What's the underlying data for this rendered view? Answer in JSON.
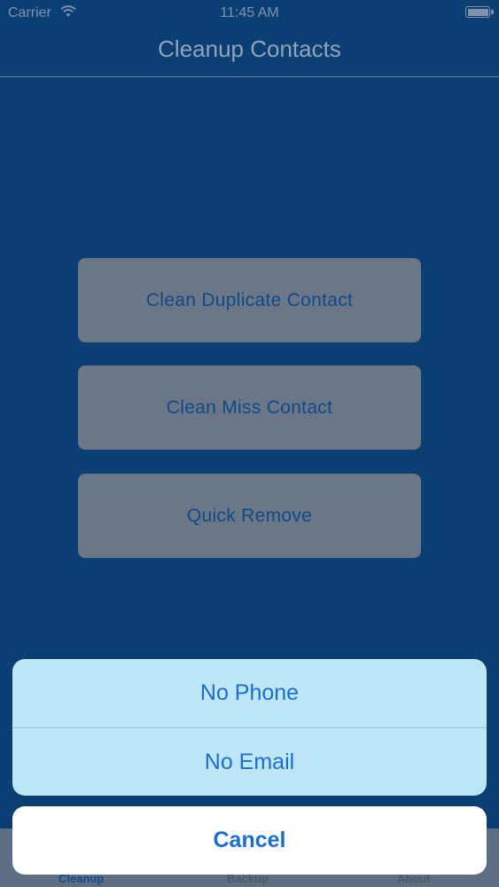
{
  "status_bar": {
    "carrier": "Carrier",
    "time": "11:45 AM",
    "wifi_icon": "wifi-icon",
    "battery_icon": "battery-icon"
  },
  "nav": {
    "title": "Cleanup Contacts"
  },
  "buttons": {
    "clean_duplicate": "Clean Duplicate Contact",
    "clean_miss": "Clean Miss Contact",
    "quick_remove": "Quick Remove"
  },
  "action_sheet": {
    "options": [
      "No Phone",
      "No Email"
    ],
    "cancel": "Cancel"
  },
  "tabbar": {
    "tabs": [
      "Cleanup",
      "Backup",
      "About"
    ],
    "selected": "Cleanup"
  },
  "colors": {
    "background": "#0b3f73",
    "button_fill": "#6b7687",
    "button_text": "#0e4a87",
    "sheet_fill": "#bde6f6",
    "sheet_text": "#1a6fd1",
    "cancel_fill": "#ffffff"
  }
}
